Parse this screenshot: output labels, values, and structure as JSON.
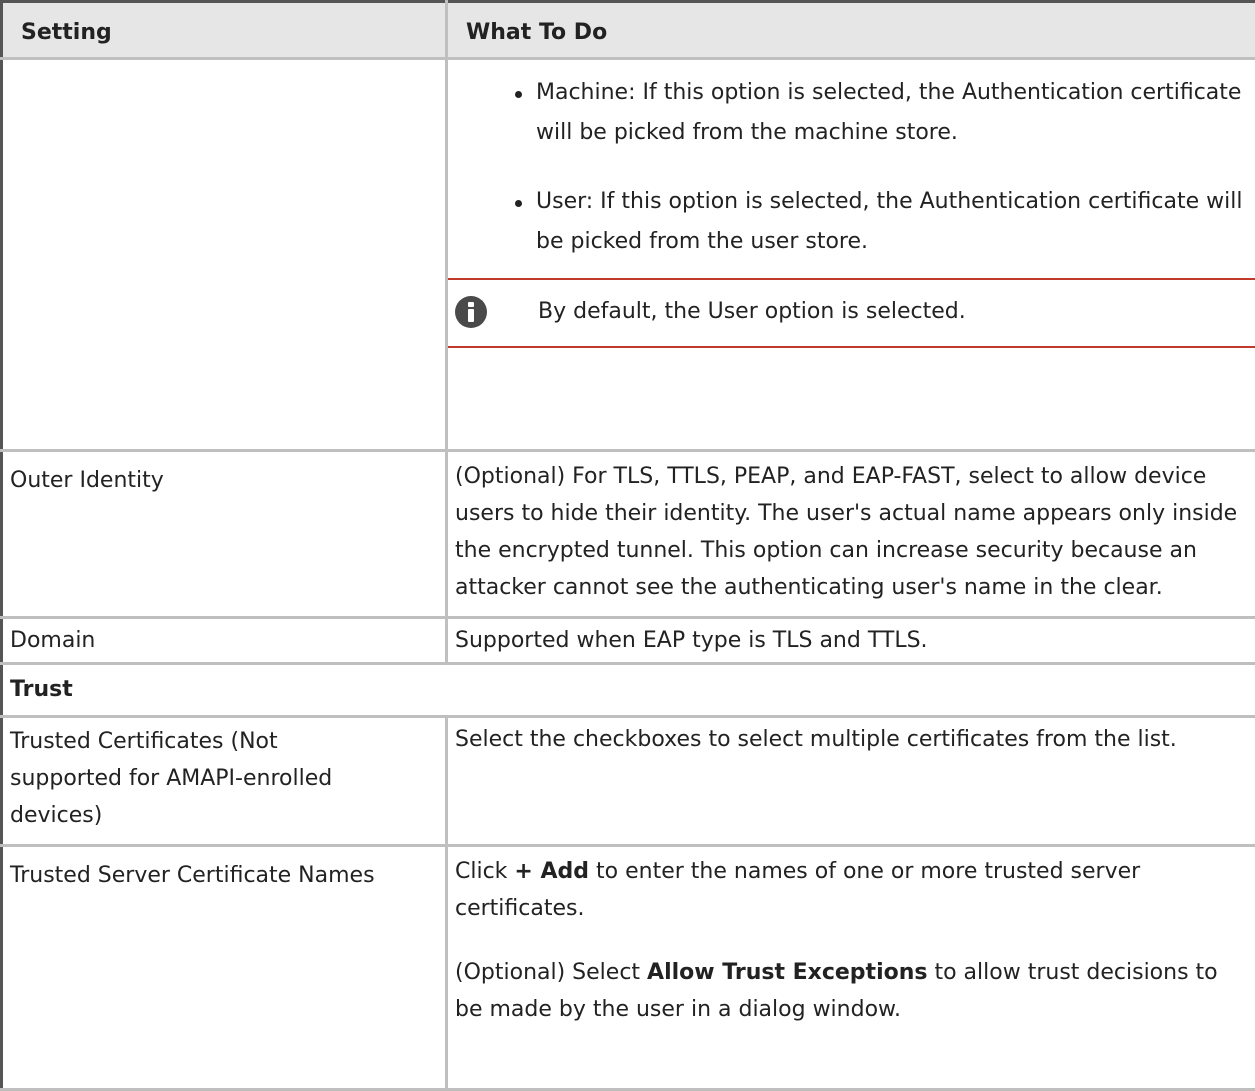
{
  "table": {
    "header": {
      "setting": "Setting",
      "what_to_do": "What To Do"
    },
    "store_options": [
      "Machine: If this option is selected, the Authentication certificate will be picked from the machine store.",
      "User: If this option is selected, the Authentication certificate will be picked from the user store."
    ],
    "note": {
      "icon": "info-icon",
      "text": "By default, the User option is selected."
    },
    "outer_identity": {
      "setting": "Outer Identity",
      "text": "(Optional) For TLS, TTLS, PEAP, and EAP-FAST, select to allow device users to hide their identity. The user's actual name appears only inside the encrypted tunnel. This option can increase security because an attacker cannot see the authenticating user's name in the clear."
    },
    "domain": {
      "setting": "Domain",
      "text": "Supported when EAP type is TLS and TTLS."
    },
    "trust_section": "Trust",
    "trusted_certificates": {
      "setting": "Trusted Certificates (Not supported for AMAPI-enrolled devices)",
      "text": "Select the checkboxes to select multiple certificates from the list."
    },
    "trusted_server_names": {
      "setting": "Trusted Server Certificate Names",
      "p1_pre": "Click ",
      "p1_bold": "+ Add",
      "p1_post": " to enter the names of one or more trusted server certificates.",
      "p2_pre": "(Optional) Select ",
      "p2_bold": "Allow Trust Exceptions",
      "p2_post": " to allow trust decisions to be made by the user in a dialog window."
    }
  }
}
